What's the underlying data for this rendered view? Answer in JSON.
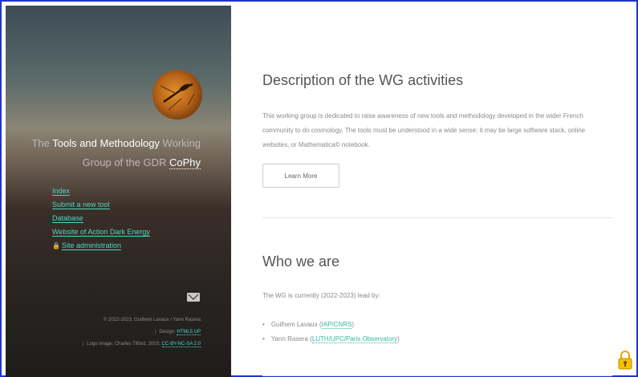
{
  "sidebar": {
    "tagline": {
      "prefix": "The ",
      "highlight": "Tools and Methodology",
      "mid": " Working Group of the GDR ",
      "link": "CoPhy"
    },
    "nav": [
      {
        "label": "Index"
      },
      {
        "label": "Submit a new tool"
      },
      {
        "label": "Database"
      },
      {
        "label": "Website of Action Dark Energy"
      },
      {
        "label": "Site administration"
      }
    ],
    "credits": {
      "copyright": "© 2022-2023, Guilhem Lavaux / Yann Rasera",
      "design_prefix": "Design: ",
      "design_link": "HTML5 UP",
      "logo_prefix": "Logo image: Charles Tilford, 2003, ",
      "logo_link": "CC-BY-NC-SA 2.0"
    }
  },
  "main": {
    "section1": {
      "title": "Description of the WG activities",
      "text": "This working group is dedicated to raise awareness of new tools and methodology developed in the wider French community to do cosmology. The tools must be understood in a wide sense: it may be large software stack, online websites, or Mathematica© notebook.",
      "button": "Learn More"
    },
    "section2": {
      "title": "Who we are",
      "text": "The WG is currently (2022-2023) lead by:",
      "members": [
        {
          "name": "Guilhem Lavaux (",
          "affil": "IAP/CNRS",
          "close": ")"
        },
        {
          "name": "Yann Rasera (",
          "affil": "LUTH/UPC/Paris Observatory",
          "close": ")"
        }
      ]
    }
  },
  "colors": {
    "accent": "#4dd8c0",
    "frame": "#2233cc"
  },
  "icons": [
    "avatar-logo",
    "lock-icon",
    "envelope-icon",
    "padlock-icon"
  ]
}
